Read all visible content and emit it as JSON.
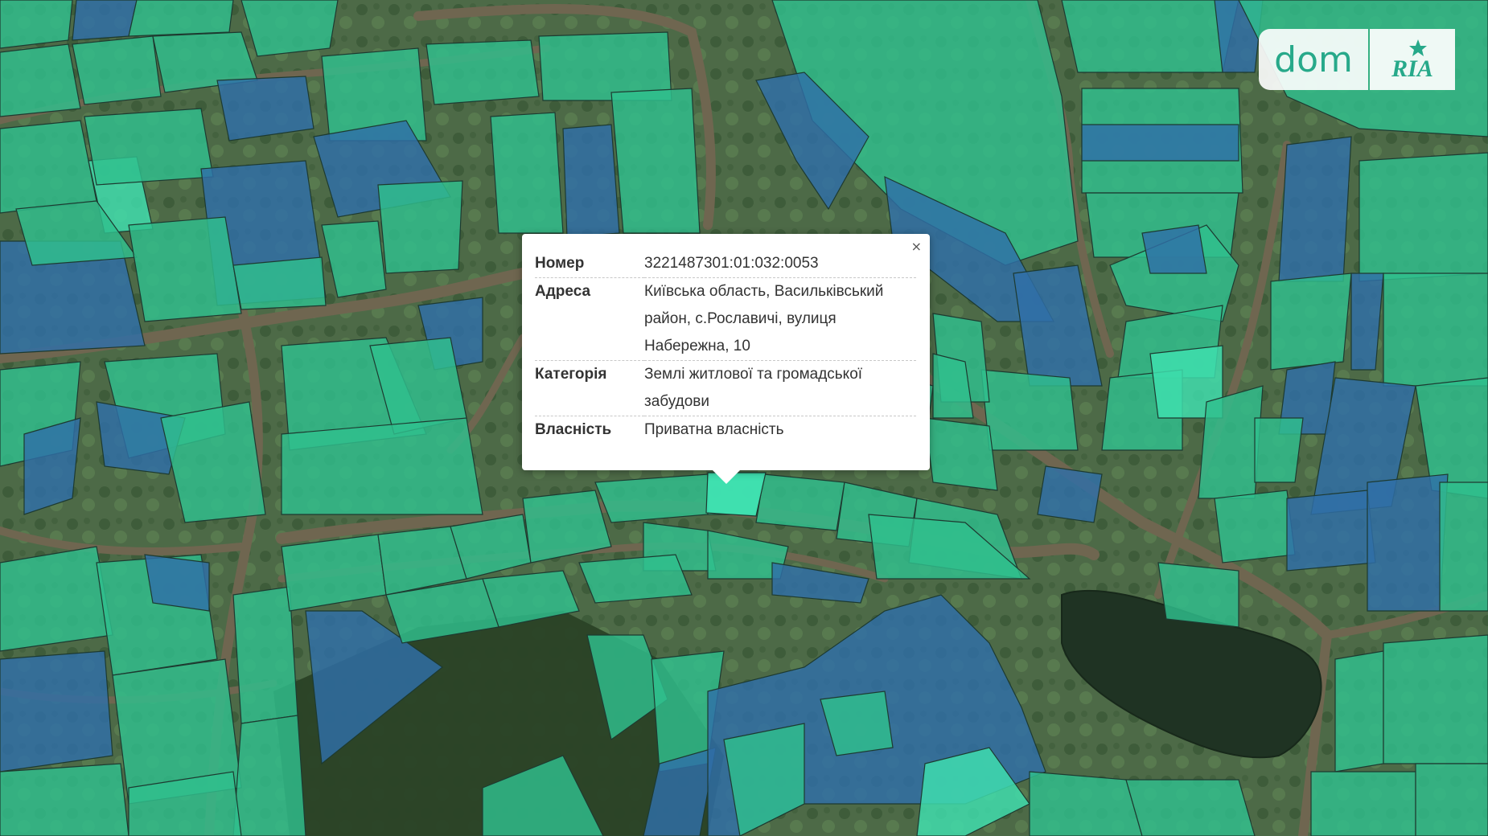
{
  "logo": {
    "dom_text": "dom",
    "ria_text": "RIA"
  },
  "popup": {
    "close_label": "×",
    "rows": [
      {
        "key": "Номер",
        "value": "3221487301:01:032:0053"
      },
      {
        "key": "Адреса",
        "value": "Київська область, Васильківський район, с.Рославичі, вулиця Набережна, 10"
      },
      {
        "key": "Категорія",
        "value": "Землі житлової та громадської забудови"
      },
      {
        "key": "Власність",
        "value": "Приватна власність"
      }
    ]
  },
  "colors": {
    "residential_parcel": "#2fbf8e",
    "other_parcel": "#2f6fa8",
    "selected_parcel": "#3fe0b0",
    "road": "#6f6650",
    "water": "#1f3323",
    "forest": "#2e4a2a"
  }
}
